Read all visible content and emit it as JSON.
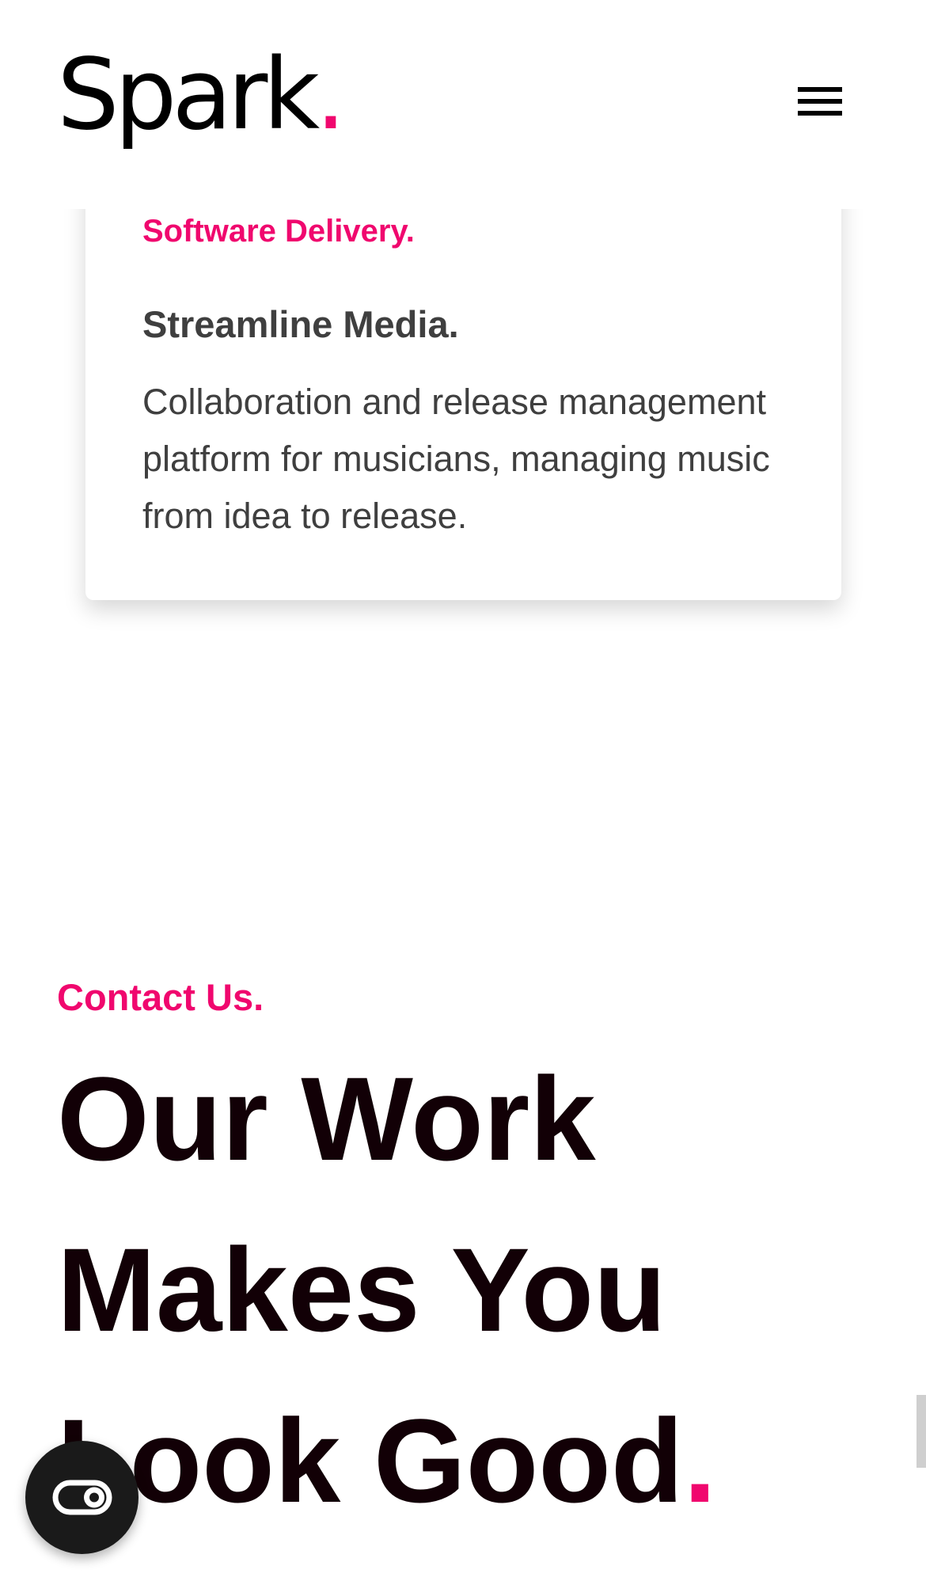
{
  "header": {
    "logo_text": "Spark",
    "logo_dot": ".",
    "menu_icon": "hamburger-menu-icon"
  },
  "card": {
    "eyebrow": "Software Delivery.",
    "title": "Streamline Media.",
    "description": "Collaboration and release management platform for musicians, managing music from idea to release."
  },
  "contact": {
    "eyebrow": "Contact Us.",
    "headline_line1": "Our Work",
    "headline_line2": "Makes You",
    "headline_line3": "Look Good",
    "headline_dot": "."
  },
  "widgets": {
    "chat_icon": "chat-toggle-icon"
  },
  "colors": {
    "accent": "#f0076e",
    "heading": "#120006",
    "body_text": "#3f3f3f",
    "launcher_bg": "#1a1a1a"
  }
}
